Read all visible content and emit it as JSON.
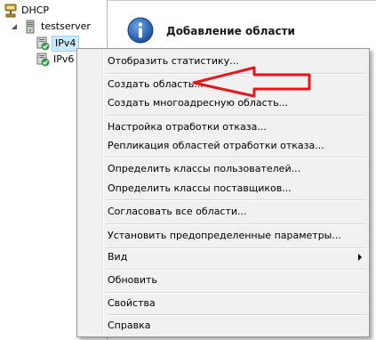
{
  "tree": {
    "root": {
      "label": "DHCP",
      "icon": "dhcp-server-icon"
    },
    "server": {
      "label": "testserver",
      "icon": "server-tower-icon"
    },
    "children": [
      {
        "label": "IPv4",
        "icon": "ipv4-check-icon",
        "selected": true
      },
      {
        "label": "IPv6",
        "icon": "ipv6-check-icon",
        "selected": false
      }
    ]
  },
  "header": {
    "title": "Добавление области",
    "icon": "info-icon"
  },
  "context_menu": {
    "items": [
      {
        "label": "Отобразить статистику..."
      },
      {
        "label": "Создать область..."
      },
      {
        "label": "Создать многоадресную область..."
      },
      {
        "label": "Настройка отработки отказа..."
      },
      {
        "label": "Репликация областей отработки отказа..."
      },
      {
        "label": "Определить классы пользователей..."
      },
      {
        "label": "Определить классы поставщиков..."
      },
      {
        "label": "Согласовать все области..."
      },
      {
        "label": "Установить предопределенные параметры..."
      },
      {
        "label": "Вид",
        "submenu": true
      },
      {
        "label": "Обновить"
      },
      {
        "label": "Свойства"
      },
      {
        "label": "Справка"
      }
    ]
  },
  "annotation": {
    "color": "#e8141c",
    "points_to": "Создать область..."
  }
}
